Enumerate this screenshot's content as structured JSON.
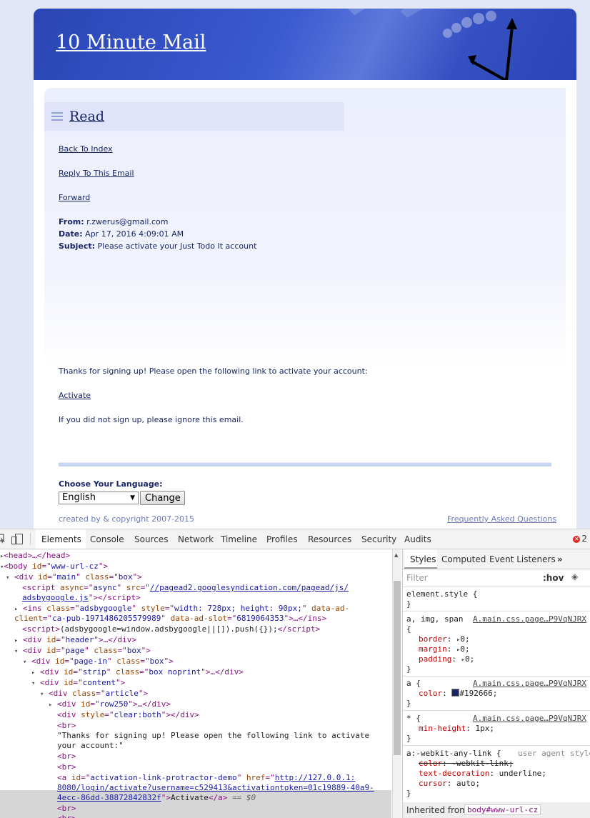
{
  "site": {
    "title": "10 Minute Mail"
  },
  "section": {
    "title": "Read"
  },
  "email_actions": {
    "back": "Back To Index",
    "reply": "Reply To This Email",
    "forward": "Forward"
  },
  "email": {
    "from_label": "From:",
    "from": "r.zwerus@gmail.com",
    "date_label": "Date:",
    "date": "Apr 17, 2016 4:09:01 AM",
    "subject_label": "Subject:",
    "subject": "Please activate your Just Todo It account",
    "body_line1": "Thanks for signing up! Please open the following link to activate your account:",
    "activate_link": "Activate",
    "body_line2": "If you did not sign up, please ignore this email."
  },
  "language": {
    "label": "Choose Your Language:",
    "selected": "English",
    "change_button": "Change"
  },
  "footer": {
    "copyright": "created by & copyright 2007-2015",
    "faq": "Frequently Asked Questions"
  },
  "devtools": {
    "tabs": [
      "Elements",
      "Console",
      "Sources",
      "Network",
      "Timeline",
      "Profiles",
      "Resources",
      "Security",
      "Audits"
    ],
    "error_count": "2",
    "dom": {
      "head": "<head>…</head>",
      "body_open_tag": "body",
      "body_id": "www-url-cz",
      "main_id": "main",
      "main_class": "box",
      "script_async": "async",
      "script_src_1": "//pagead2.googlesyndication.com/pagead/js/",
      "script_src_2": "adsbygoogle.js",
      "ins_class": "adsbygoogle",
      "ins_style": "width: 728px; height: 90px;",
      "ins_client": "ca-pub-1971486205579989",
      "ins_slot": "6819064353",
      "push_script": "(adsbygoogle=window.adsbygoogle||[]).push({});",
      "header_id": "header",
      "page_id": "page",
      "page_class": "box",
      "pagein_id": "page-in",
      "pagein_class": "box",
      "strip_id": "strip",
      "strip_class": "box noprint",
      "content_id": "content",
      "article_class": "article",
      "row_id": "row250",
      "clear_style": "clear:both",
      "text_node_1": "\"Thanks for signing up! Please open the following link to activate",
      "text_node_2": "your account:\"",
      "anchor_id": "activation-link-protractor-demo",
      "anchor_href_1": "http://127.0.0.1:",
      "anchor_href_2": "8080/login/activate?username=c529413&activationtoken=01c19889-40a9-",
      "anchor_href_3": "4ecc-86dd-38872842832f",
      "anchor_text": "Activate",
      "selected_marker": "== $0"
    },
    "styles": {
      "tabs": [
        "Styles",
        "Computed",
        "Event Listeners"
      ],
      "filter_placeholder": "Filter",
      "hov": ":hov",
      "element_style": "element.style {",
      "rule1_selector": "a, img, span",
      "rule1_source": "A.main.css.page…P9VqNJRX",
      "rule1_props": [
        [
          "border",
          "0;"
        ],
        [
          "margin",
          "0;"
        ],
        [
          "padding",
          "0;"
        ]
      ],
      "rule2_selector": "a {",
      "rule2_source": "A.main.css.page…P9VqNJRX",
      "rule2_prop": "color",
      "rule2_value": "#192666;",
      "rule3_selector": "* {",
      "rule3_source": "A.main.css.page…P9VqNJRX",
      "rule3_prop": "min-height",
      "rule3_value": "1px;",
      "rule4_selector": "a:-webkit-any-link {",
      "rule4_source": "user agent style",
      "rule4_props": [
        [
          "color",
          "-webkit-link;"
        ],
        [
          "text-decoration",
          "underline;"
        ],
        [
          "cursor",
          "auto;"
        ]
      ],
      "inherited_label": "Inherited from",
      "inherited_chip": "body#www-url-cz"
    }
  },
  "colors": {
    "link": "#192666",
    "header_blue": "#2a46b4"
  }
}
